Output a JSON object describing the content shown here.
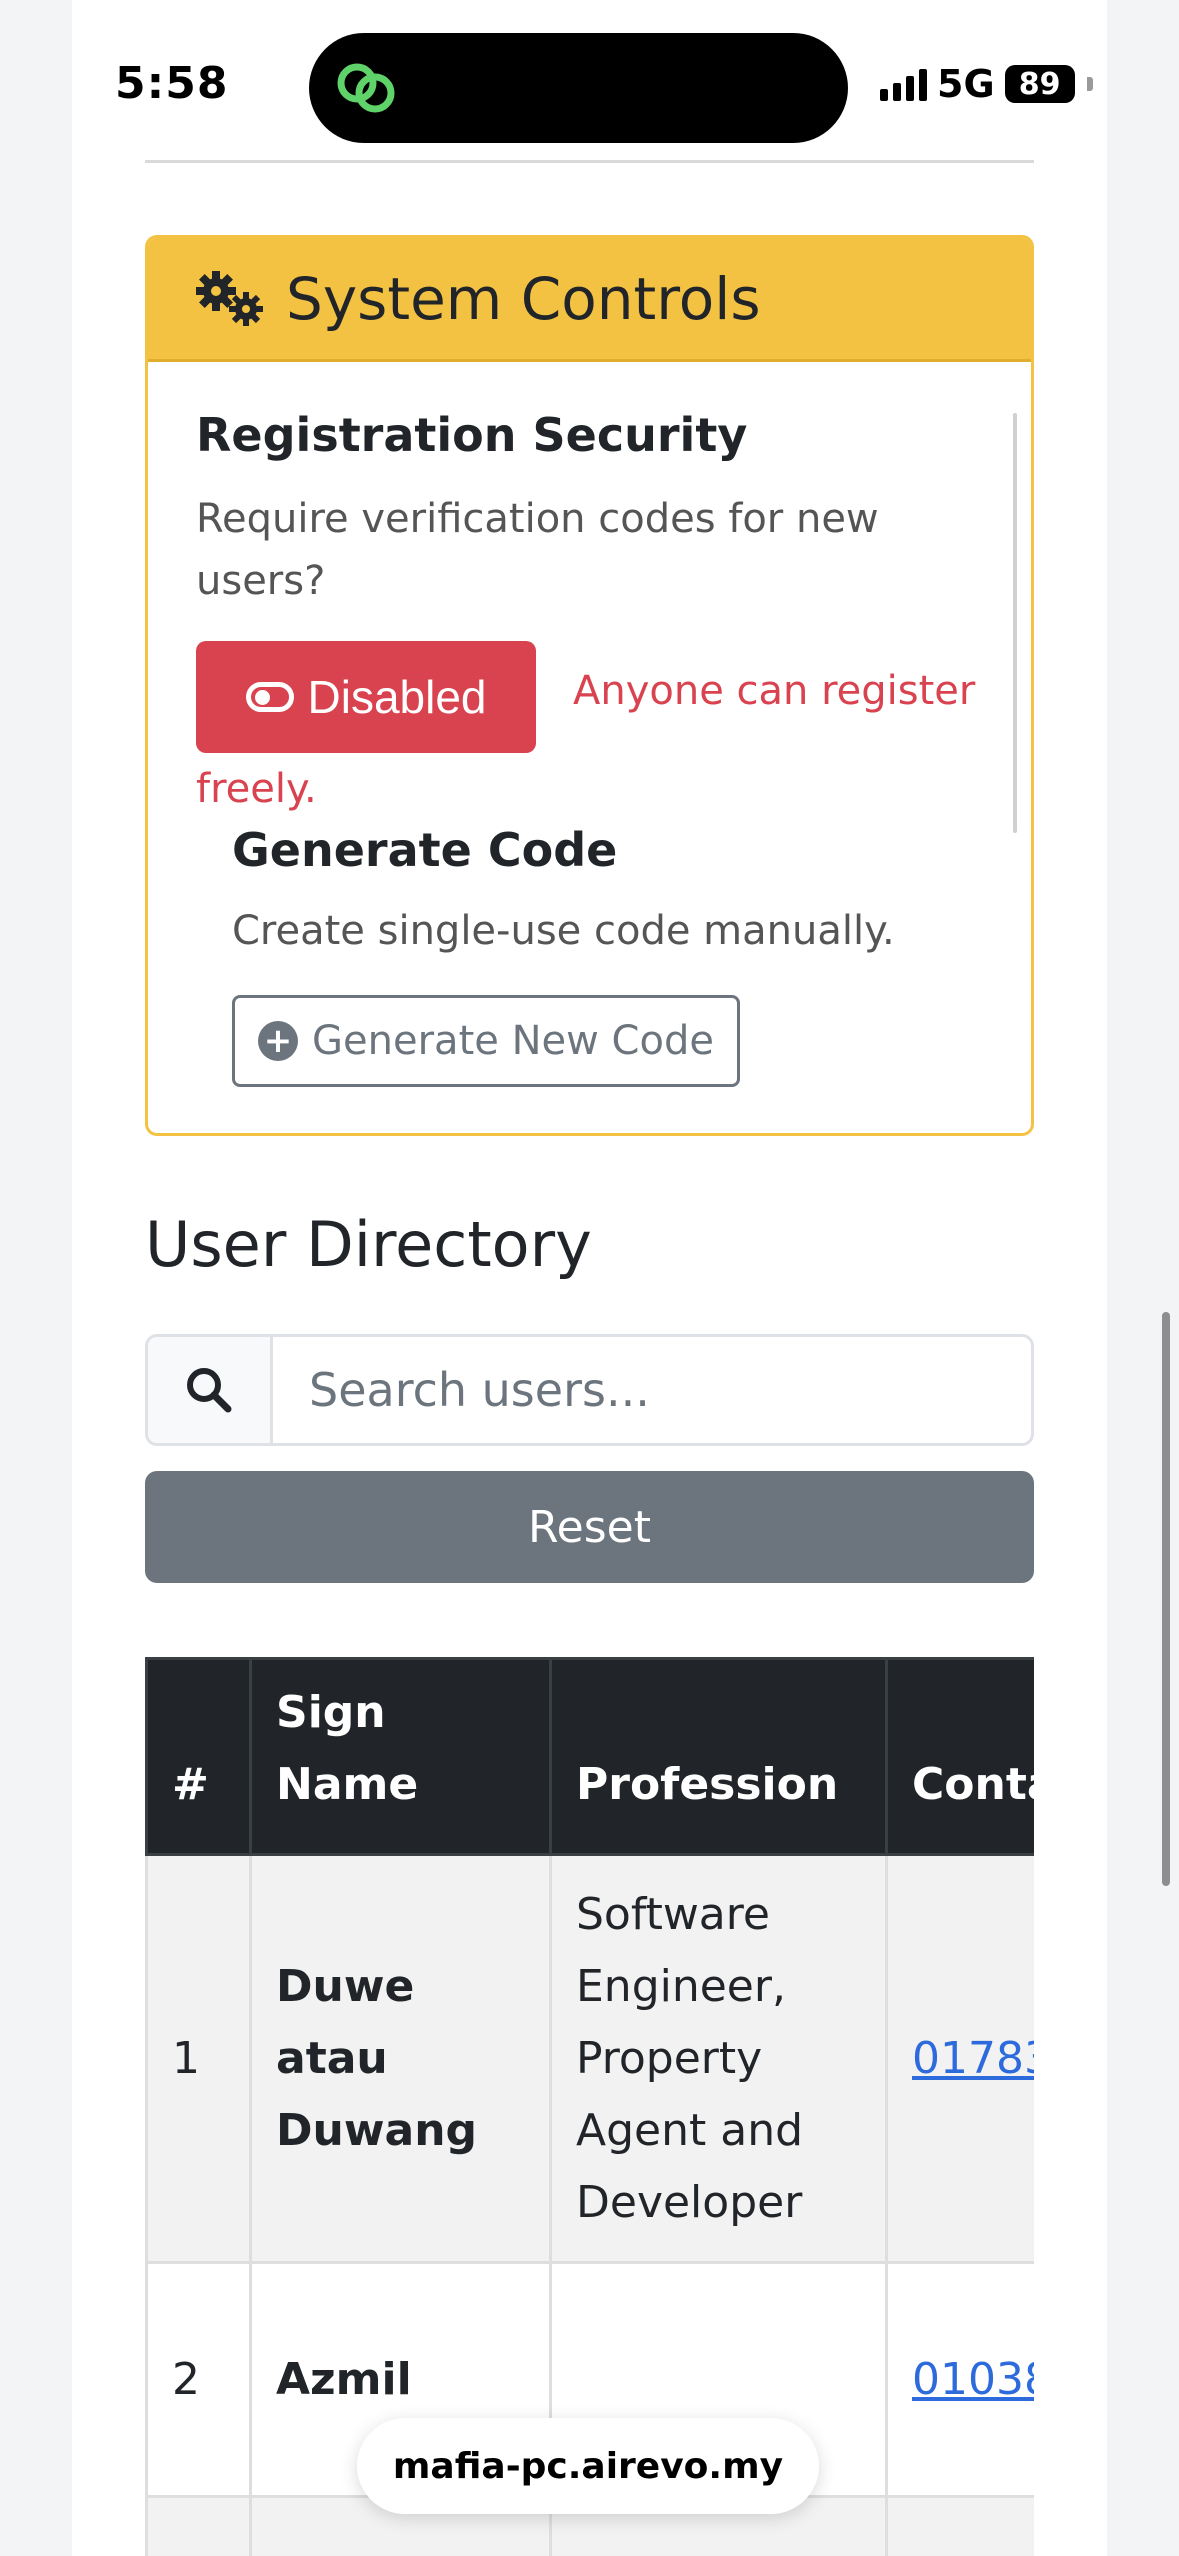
{
  "status_bar": {
    "time": "5:58",
    "network": "5G",
    "battery": "89",
    "app_icon": "link-chain-icon"
  },
  "system_controls": {
    "title": "System Controls",
    "icon": "gears-icon",
    "registration": {
      "title": "Registration Security",
      "description": "Require verification codes for new users?",
      "toggle_label": "Disabled",
      "status_text_line1": "Anyone can register",
      "status_text_line2": "freely."
    },
    "generate": {
      "title": "Generate Code",
      "description": "Create single-use code manually.",
      "button_label": "Generate New Code"
    }
  },
  "user_directory": {
    "title": "User Directory",
    "search_placeholder": "Search users...",
    "reset_label": "Reset",
    "columns": [
      "#",
      "Sign Name",
      "Profession",
      "Conta"
    ],
    "rows": [
      {
        "num": "1",
        "name": "Duwe atau Duwang",
        "profession": "Software Engineer, Property Agent and Developer",
        "contact": "01783"
      },
      {
        "num": "2",
        "name": "Azmil",
        "profession": "",
        "contact": "01038"
      }
    ]
  },
  "browser": {
    "url": "mafia-pc.airevo.my"
  },
  "colors": {
    "warning": "#f4c242",
    "danger": "#d9434f",
    "secondary": "#6c757d",
    "dark": "#212529",
    "link": "#2d6bdc"
  }
}
